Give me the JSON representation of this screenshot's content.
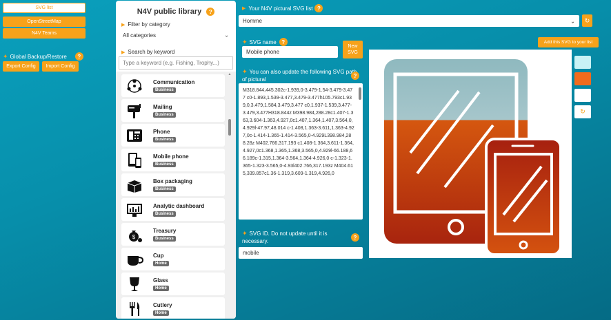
{
  "left": {
    "nav_buttons": [
      "SVG list",
      "OpenStreetMap",
      "N4V Teams"
    ],
    "backup_title": "Global Backup/Restore",
    "export_label": "Export Config",
    "import_label": "Import Config"
  },
  "library": {
    "title": "N4V public library",
    "filter_label": "Filter by category",
    "category_selected": "All categories",
    "search_label": "Search by keyword",
    "search_placeholder": "Type a keyword (e.g. Fishing, Trophy...)",
    "items": [
      {
        "name": "Communication",
        "category": "Business",
        "icon": "communication-icon"
      },
      {
        "name": "Mailing",
        "category": "Business",
        "icon": "mailbox-icon"
      },
      {
        "name": "Phone",
        "category": "Business",
        "icon": "phone-icon"
      },
      {
        "name": "Mobile phone",
        "category": "Business",
        "icon": "mobile-phone-icon"
      },
      {
        "name": "Box packaging",
        "category": "Business",
        "icon": "box-icon"
      },
      {
        "name": "Analytic dashboard",
        "category": "Business",
        "icon": "dashboard-icon"
      },
      {
        "name": "Treasury",
        "category": "Business",
        "icon": "money-bag-icon"
      },
      {
        "name": "Cup",
        "category": "Home",
        "icon": "cup-icon"
      },
      {
        "name": "Glass",
        "category": "Home",
        "icon": "glass-icon"
      },
      {
        "name": "Cutlery",
        "category": "Home",
        "icon": "cutlery-icon"
      }
    ]
  },
  "editor": {
    "list_title": "Your N4V pictural SVG list",
    "list_selected": "Homme",
    "name_label": "SVG name",
    "name_value": "Mobile phone",
    "new_svg_label": "New SVG",
    "path_label": "You can also update the following SVG path of pictural",
    "path_value": "M318.844,445.302c-1.939,0-3.479-1.54-3.479-3.477    c0-1.893,1.539-3.477,3.479-3.477h105.793c1.939,0,3.479,1.584,3.479,3.477 c0,1.937-1.539,3.477-3.479,3.477H318.844z M398.984,288.28c1.407-1.363,3.604-1.363,4.927,0c1.407,1.364,1.407,3.564,0,4.929l-47.97,48.014    c-1.408,1.363-3.611,1.363-4.927,0c-1.414-1.365-1.414-3.565,0-4.929L398.984,288.28z M402.766,317.193 c1.408-1.364,3.611-1.364,4.927,0c1.368,1.365,1.368,3.565,0,4.929l-66.188,66.189c-1.315,1.364-3.564,1.364-4.926,0    c-1.323-1.365-1.323-3.565,0-4.93l402.766,317.193z M404.615,339.857c1.36-1.319,3.609-1.319,4.926,0",
    "id_label": "SVG ID. Do not update until it is necessary.",
    "id_value": "mobile",
    "add_label": "Add this SVG to your list"
  },
  "colors": {
    "accent": "#f7a21a",
    "gradient_top": "#8fb9bf",
    "gradient_bottom": "#c8390d",
    "swatches": [
      "#c8f2f5",
      "#f26b1d",
      "#ffffff"
    ]
  }
}
